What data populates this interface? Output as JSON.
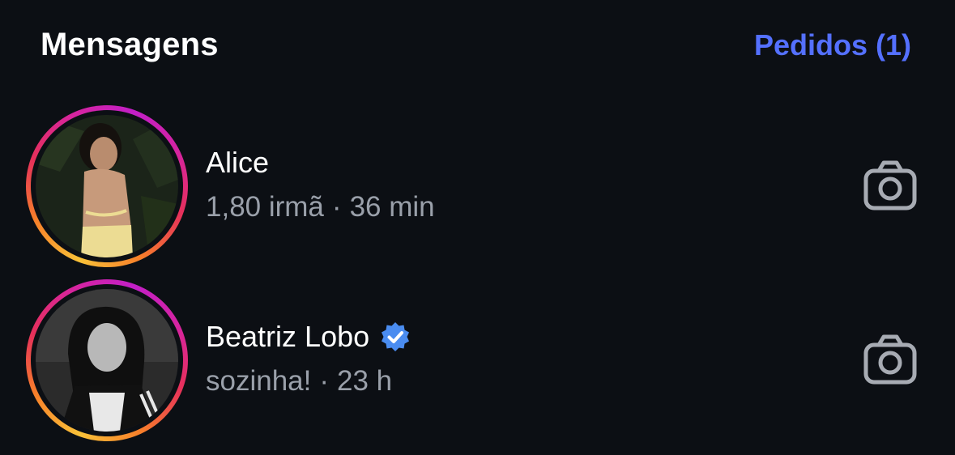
{
  "header": {
    "title": "Mensagens",
    "requests_label": "Pedidos (1)"
  },
  "threads": [
    {
      "name": "Alice",
      "verified": false,
      "preview": "1,80 irmã",
      "separator": "·",
      "time": "36 min"
    },
    {
      "name": "Beatriz Lobo",
      "verified": true,
      "preview": "sozinha!",
      "separator": "·",
      "time": "23 h"
    }
  ],
  "colors": {
    "background": "#0c0f14",
    "accent": "#5470ff",
    "secondary_text": "#9aa0aa",
    "verified": "#4a8cf0",
    "icon": "#a7abb3"
  },
  "icons": {
    "camera": "camera-icon",
    "verified": "verified-badge-icon"
  }
}
